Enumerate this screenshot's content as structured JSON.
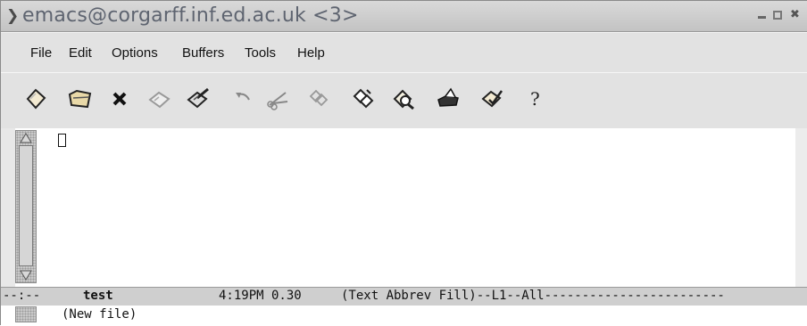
{
  "window": {
    "title": "emacs@corgarff.inf.ed.ac.uk <3>",
    "menu_icon": "chevron-down-icon",
    "controls": [
      "minimize-icon",
      "maximize-icon",
      "close-icon"
    ]
  },
  "menubar": {
    "items": [
      "File",
      "Edit",
      "Options",
      "Buffers",
      "Tools",
      "Help"
    ]
  },
  "toolbar": {
    "icons": [
      "new-file-icon",
      "open-folder-icon",
      "close-icon",
      "save-icon",
      "save-as-icon",
      "undo-icon",
      "cut-icon",
      "copy-icon",
      "paste-icon",
      "search-icon",
      "print-icon",
      "customize-icon",
      "help-icon"
    ]
  },
  "modeline": {
    "status": "--:--",
    "buffer": "test",
    "time_load": "4:19PM 0.30",
    "modes": "(Text Abbrev Fill)--L1--All------------------------"
  },
  "echo": {
    "message": "(New file)"
  }
}
